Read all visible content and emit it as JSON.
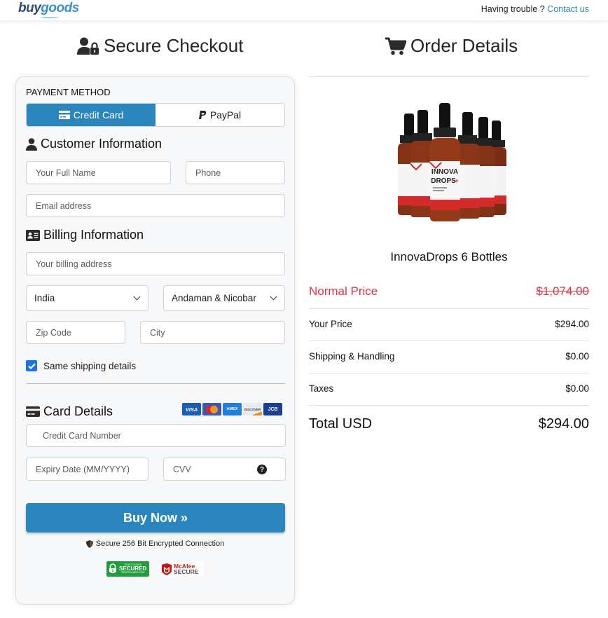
{
  "header": {
    "logo_part1": "buy",
    "logo_part2": "goods",
    "help_text": "Having trouble ?",
    "contact_link": "Contact us"
  },
  "checkout": {
    "title": "Secure Checkout",
    "payment_method_label": "PAYMENT METHOD",
    "payment_tabs": [
      {
        "label": "Credit Card",
        "icon": "credit-card-icon",
        "active": true
      },
      {
        "label": "PayPal",
        "icon": "paypal-icon",
        "active": false
      }
    ],
    "customer_info": {
      "title": "Customer Information",
      "full_name_placeholder": "Your Full Name",
      "phone_placeholder": "Phone",
      "email_placeholder": "Email address"
    },
    "billing_info": {
      "title": "Billing Information",
      "address_placeholder": "Your billing address",
      "country_selected": "India",
      "state_selected": "Andaman & Nicobar",
      "zip_placeholder": "Zip Code",
      "city_placeholder": "City",
      "same_shipping_label": "Same shipping details",
      "same_shipping_checked": true
    },
    "card_details": {
      "title": "Card Details",
      "card_brands": [
        "VISA",
        "MasterCard",
        "AMEX",
        "DISCOVER",
        "JCB"
      ],
      "card_number_placeholder": "Credit Card Number",
      "expiry_placeholder": "Expiry Date (MM/YYYY)",
      "cvv_placeholder": "CVV",
      "cvv_help": "?"
    },
    "buy_button": "Buy Now »",
    "secure_text": "Secure 256 Bit Encrypted Connection",
    "badges": {
      "trustguard_top": "TRUST GUARD",
      "trustguard_main": "SECURED",
      "trustguard_bottom": "TRUSTGUARD.COM",
      "mcafee_top": "McAfee",
      "mcafee_bottom": "SECURE"
    }
  },
  "order": {
    "title": "Order Details",
    "product_name": "InnovaDrops 6 Bottles",
    "product_label_text": "INNOVA DROPS",
    "normal_price_label": "Normal Price",
    "normal_price": "$1,074.00",
    "your_price_label": "Your Price",
    "your_price": "$294.00",
    "shipping_label": "Shipping & Handling",
    "shipping": "$0.00",
    "taxes_label": "Taxes",
    "taxes": "$0.00",
    "total_label": "Total USD",
    "total": "$294.00"
  },
  "colors": {
    "primary": "#2a86bd",
    "danger": "#dc3545",
    "checkbox": "#1a73e8"
  }
}
